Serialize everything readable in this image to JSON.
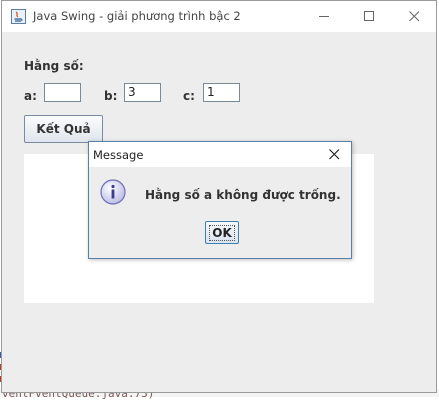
{
  "window": {
    "title": "Java Swing - giải phương trình bậc 2"
  },
  "form": {
    "heading": "Hằng số:",
    "a_label": "a:",
    "a_value": "",
    "b_label": "b:",
    "b_value": "3",
    "c_label": "c:",
    "c_value": "1",
    "result_button": "Kết Quả",
    "result_text": ""
  },
  "dialog": {
    "title": "Message",
    "message": "Hằng số a không được trống.",
    "ok_label": "OK"
  },
  "background": {
    "code_snippet": "ventFventQueue.java:73)"
  },
  "colors": {
    "window_bg": "#ededed",
    "dialog_border": "#5b7fa8",
    "button_border": "#7a8aa3"
  }
}
